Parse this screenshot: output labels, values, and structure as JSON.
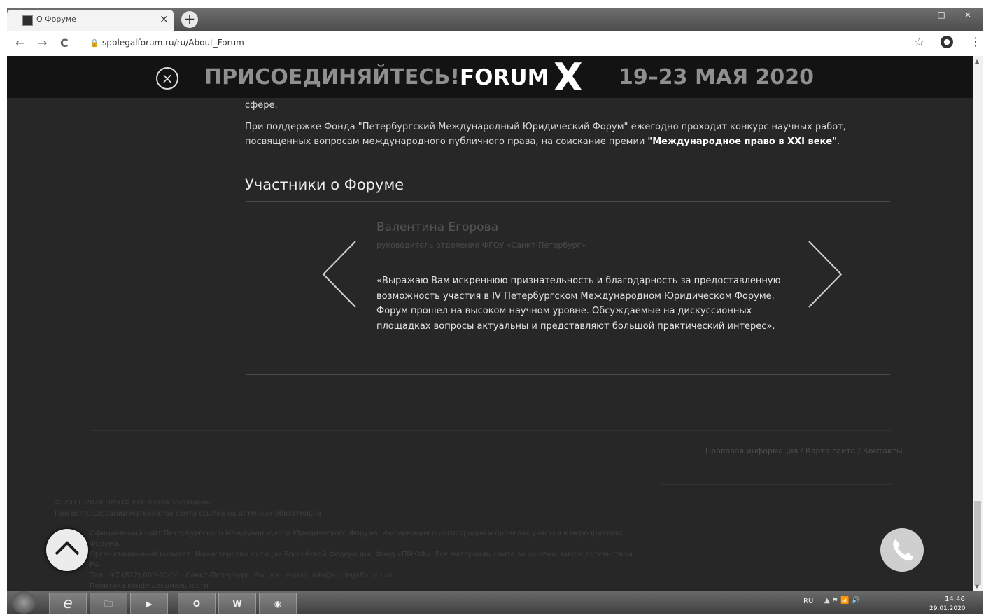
{
  "browser": {
    "tab_title": "О Форуме",
    "tab_close": "×",
    "new_tab": "+",
    "back": "←",
    "forward": "→",
    "reload": "C",
    "url": "spblegalforum.ru/ru/About_Forum",
    "minimize": "–",
    "maximize": "□",
    "close": "×"
  },
  "banner": {
    "close_symbol": "×",
    "join": "ПРИСОЕДИНЯЙТЕСЬ!",
    "forum": "FORUM",
    "roman": "X",
    "dates": "19–23 МАЯ 2020"
  },
  "content": {
    "tail": "сфере.",
    "paragraph": "При поддержке Фонда \"Петербургский Международный Юридический Форум\" ежегодно проходит конкурс научных работ, посвященных вопросам международного публичного права, на соискание премии ",
    "prize": "\"Международное право в XXI веке\"",
    "paragraph_end": ".",
    "section_title": "Участники о Форуме"
  },
  "testimonial": {
    "name": "Валентина Егорова",
    "role": "руководитель отделения ФГОУ «Санкт-Петербург»",
    "quote": "«Выражаю Вам искреннюю признательность и благодарность за предоставленную возможность участия в IV Петербургском Международном Юридическом Форуме. Форум прошел на высоком научном уровне. Обсуждаемые на дискуссионных площадках вопросы актуальны и представляют большой практический интерес»."
  },
  "footer": {
    "links": "Правовая информация / Карта сайта / Контакты",
    "copyright": "© 2011–2020 ПМЮФ Все права защищены",
    "note": "При использовании материалов сайта ссылка на источник обязательна",
    "legal_1": "Официальный сайт Петербургского Международного Юридического Форума. Информация о регистрации и правилах участия в мероприятиях Форума.",
    "legal_2": "Организационный комитет: Министерство юстиции Российской Федерации, Фонд «ПМЮФ». Все материалы сайта защищены законодательством РФ.",
    "legal_3": "Тел.: +7 (812) 000-00-00 · Санкт-Петербург, Россия · e-mail: info@spblegalforum.ru",
    "legal_4": "Политика конфиденциальности"
  },
  "taskbar": {
    "lang": "RU",
    "tray": "▲ ⚑ 📶 🔊",
    "time": "14:46",
    "date": "29.01.2020",
    "apps": [
      "e",
      "🗀",
      "▶",
      "O",
      "W",
      "◉"
    ]
  },
  "icons": {
    "favicon": "forum-favicon",
    "star": "star-icon",
    "account": "account-icon",
    "menu": "kebab-menu-icon",
    "up": "chevron-up-icon",
    "phone": "phone-icon"
  },
  "colors": {
    "page_bg": "#272727",
    "banner_bg": "#131313",
    "accent_text": "#ffffff",
    "muted_text": "#8f8f8f"
  }
}
